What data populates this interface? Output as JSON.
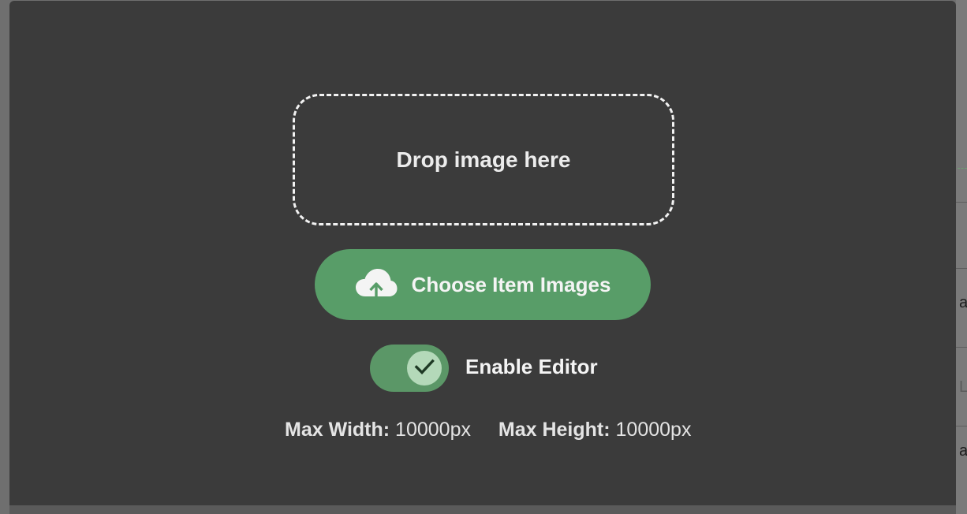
{
  "modal": {
    "dropzone_text": "Drop image here",
    "choose_button_label": "Choose Item Images",
    "choose_button_icon": "cloud-upload-icon",
    "toggle": {
      "label": "Enable Editor",
      "checked": true,
      "icon": "check-icon"
    },
    "limits": {
      "max_width_label": "Max Width:",
      "max_width_value": "10000px",
      "max_height_label": "Max Height:",
      "max_height_value": "10000px"
    }
  },
  "background_page": {
    "fragments": [
      "a",
      "Li",
      "a"
    ]
  },
  "colors": {
    "modal_bg": "#3b3b3b",
    "accent_green": "#589d68",
    "toggle_knob": "#b4d9b9",
    "overlay": "#6f6f6f"
  }
}
